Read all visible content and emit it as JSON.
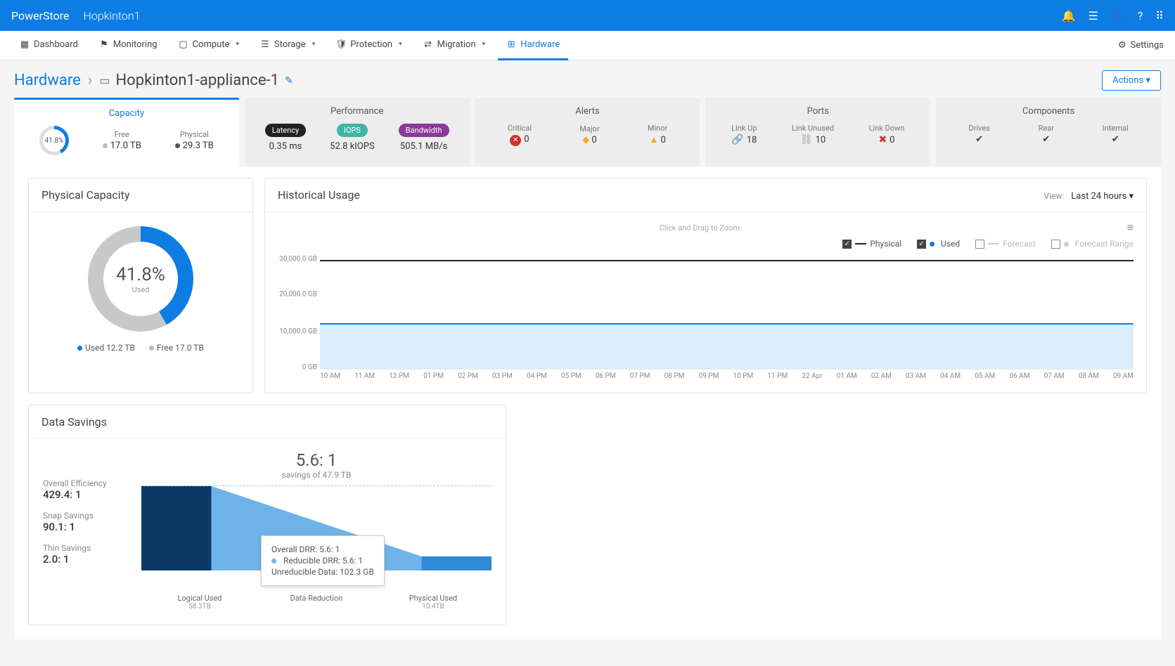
{
  "topbar": {
    "brand": "PowerStore",
    "cluster": "Hopkinton1"
  },
  "menu": {
    "items": [
      {
        "label": "Dashboard",
        "icon": "▦"
      },
      {
        "label": "Monitoring",
        "icon": "⚑"
      },
      {
        "label": "Compute",
        "icon": "▢",
        "caret": true
      },
      {
        "label": "Storage",
        "icon": "☰",
        "caret": true
      },
      {
        "label": "Protection",
        "icon": "🛡",
        "caret": true
      },
      {
        "label": "Migration",
        "icon": "⇄",
        "caret": true
      },
      {
        "label": "Hardware",
        "icon": "⊞",
        "active": true
      }
    ],
    "settings": "Settings"
  },
  "breadcrumb": {
    "root": "Hardware",
    "current": "Hopkinton1-appliance-1"
  },
  "actions_label": "Actions",
  "tabs": {
    "capacity": {
      "title": "Capacity",
      "pct": "41.8%",
      "free_label": "Free",
      "free_val": "17.0 TB",
      "phys_label": "Physical",
      "phys_val": "29.3 TB"
    },
    "performance": {
      "title": "Performance",
      "latency_label": "Latency",
      "latency_val": "0.35 ms",
      "iops_label": "IOPS",
      "iops_val": "52.8 kIOPS",
      "bw_label": "Bandwidth",
      "bw_val": "505.1 MB/s"
    },
    "alerts": {
      "title": "Alerts",
      "critical_label": "Critical",
      "critical_val": "0",
      "major_label": "Major",
      "major_val": "0",
      "minor_label": "Minor",
      "minor_val": "0"
    },
    "ports": {
      "title": "Ports",
      "up_label": "Link Up",
      "up_val": "18",
      "unused_label": "Link Unused",
      "unused_val": "10",
      "down_label": "Link Down",
      "down_val": "0"
    },
    "components": {
      "title": "Components",
      "drives_label": "Drives",
      "rear_label": "Rear",
      "internal_label": "Internal"
    }
  },
  "phys_capacity": {
    "title": "Physical Capacity",
    "pct": "41.8%",
    "pct_sub": "Used",
    "used_label": "Used 12.2 TB",
    "free_label": "Free 17.0 TB"
  },
  "historical": {
    "title": "Historical Usage",
    "view_label": "View:",
    "view_value": "Last 24 hours",
    "zoom_hint": "Click and Drag to Zoom",
    "legend": {
      "physical": "Physical",
      "used": "Used",
      "forecast": "Forecast",
      "forecast_range": "Forecast Range"
    }
  },
  "chart_data": {
    "type": "area",
    "xlabel": "",
    "ylabel": "",
    "ylim": [
      0,
      30000
    ],
    "y_ticks": [
      "30,000.0 GB",
      "20,000.0 GB",
      "10,000.0 GB",
      "0 GB"
    ],
    "x_ticks": [
      "10 AM",
      "11 AM",
      "12 PM",
      "01 PM",
      "02 PM",
      "03 PM",
      "04 PM",
      "05 PM",
      "06 PM",
      "07 PM",
      "08 PM",
      "09 PM",
      "10 PM",
      "11 PM",
      "22 Apr",
      "01 AM",
      "02 AM",
      "03 AM",
      "04 AM",
      "05 AM",
      "06 AM",
      "07 AM",
      "08 AM",
      "09 AM"
    ],
    "series": [
      {
        "name": "Physical",
        "value_constant": 29300
      },
      {
        "name": "Used",
        "value_constant": 12200
      }
    ]
  },
  "savings": {
    "title": "Data Savings",
    "overall_label": "Overall Efficiency",
    "overall_val": "429.4: 1",
    "snap_label": "Snap Savings",
    "snap_val": "90.1: 1",
    "thin_label": "Thin Savings",
    "thin_val": "2.0: 1",
    "ratio": "5.6: 1",
    "ratio_sub": "savings of 47.9 TB",
    "logical_label": "Logical Used",
    "logical_val": "58.3TB",
    "datared_label": "Data Reduction",
    "physused_label": "Physical Used",
    "physused_val": "10.4TB",
    "tooltip": {
      "l1": "Overall DRR: 5.6: 1",
      "l2": "Reducible DRR: 5.6: 1",
      "l3": "Unreducible Data: 102.3 GB"
    }
  }
}
